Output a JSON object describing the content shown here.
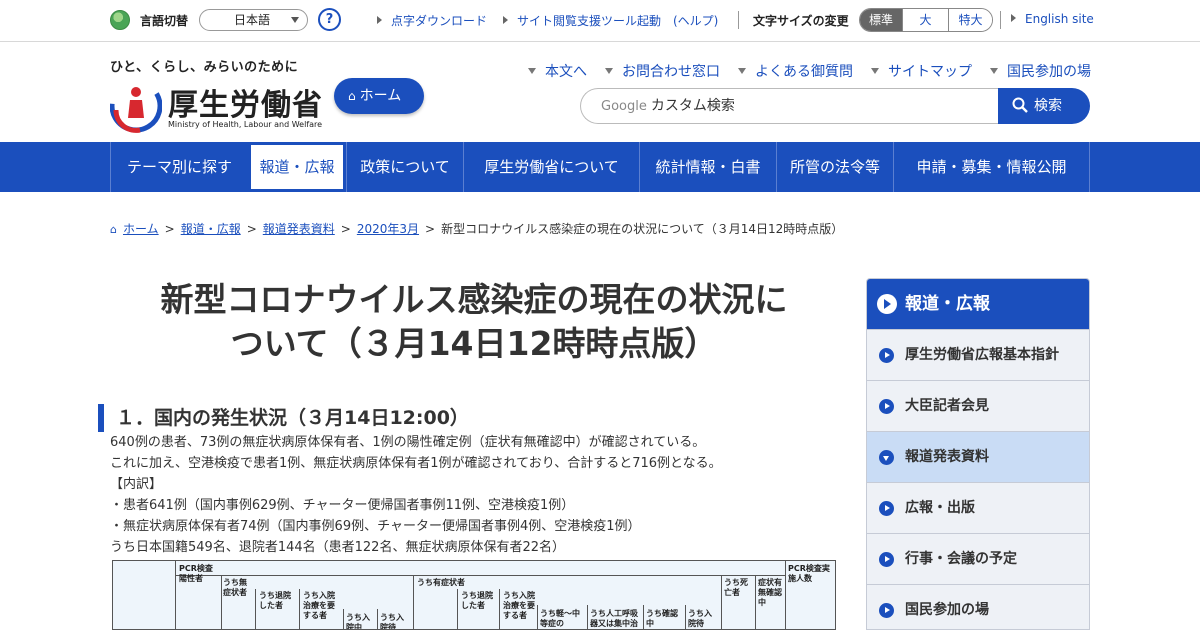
{
  "utility": {
    "lang_label": "言語切替",
    "lang_value": "日本語",
    "help": "?",
    "links": [
      {
        "label": "点字ダウンロード"
      },
      {
        "label": "サイト閲覧支援ツール起動　(ヘルプ)"
      },
      {
        "label": "English site"
      }
    ],
    "font_size_label": "文字サイズの変更",
    "font_sizes": [
      {
        "label": "標準",
        "active": true
      },
      {
        "label": "大",
        "active": false
      },
      {
        "label": "特大",
        "active": false
      }
    ]
  },
  "header": {
    "tagline": "ひと、くらし、みらいのために",
    "logo_text": "厚生労働省",
    "logo_en": "Ministry of Health, Labour and Welfare",
    "home_button": "ホーム",
    "links": [
      {
        "label": "本文へ"
      },
      {
        "label": "お問合わせ窓口"
      },
      {
        "label": "よくある御質問"
      },
      {
        "label": "サイトマップ"
      },
      {
        "label": "国民参加の場"
      }
    ],
    "search": {
      "google": "Google",
      "placeholder": "カスタム検索",
      "button": "検索"
    }
  },
  "gnav": [
    {
      "label": "テーマ別に探す"
    },
    {
      "label": "報道・広報",
      "active": true
    },
    {
      "label": "政策について"
    },
    {
      "label": "厚生労働省について"
    },
    {
      "label": "統計情報・白書"
    },
    {
      "label": "所管の法令等"
    },
    {
      "label": "申請・募集・情報公開"
    }
  ],
  "breadcrumb": {
    "links": [
      "ホーム",
      "報道・広報",
      "報道発表資料",
      "2020年3月"
    ],
    "current": "新型コロナウイルス感染症の現在の状況について（３月14日12時時点版）"
  },
  "main": {
    "title_line1": "新型コロナウイルス感染症の現在の状況に",
    "title_line2": "ついて（３月14日12時時点版）",
    "section_heading": "１．国内の発生状況（３月14日12:00）",
    "lines": [
      "640例の患者、73例の無症状病原体保有者、1例の陽性確定例（症状有無確認中）が確認されている。",
      "これに加え、空港検疫で患者1例、無症状病原体保有者1例が確認されており、合計すると716例となる。",
      "【内訳】",
      "・患者641例（国内事例629例、チャーター便帰国者事例11例、空港検疫1例）",
      "・無症状病原体保有者74例（国内事例69例、チャーター便帰国者事例4例、空港検疫1例）",
      "うち日本国籍549名、退院者144名（患者122名、無症状病原体保有者22名）"
    ],
    "table": {
      "h_pcr": "PCR検査陽性者",
      "h_patients": "うち無症状者",
      "h_discharged": "うち退院した者",
      "h_hosp": "うち入院治療を要する者",
      "h_hosp2": "うち入院中",
      "h_hosp3": "うち入院待",
      "h_symptom": "うち有症状者",
      "h_disc2": "うち退院した者",
      "h_hosp4": "うち入院治療を要する者",
      "h_mild": "うち軽～中等症の",
      "h_severe": "うち人工呼吸器又は集中治",
      "h_confirm": "うち確認中",
      "h_hosp5": "うち入院待",
      "h_death": "うち死亡者",
      "h_unknown": "症状有無確認中",
      "h_tested": "PCR検査実施人数"
    }
  },
  "sidenav": {
    "title": "報道・広報",
    "items": [
      {
        "label": "厚生労働省広報基本指針",
        "active": false
      },
      {
        "label": "大臣記者会見",
        "active": false
      },
      {
        "label": "報道発表資料",
        "active": true
      },
      {
        "label": "広報・出版",
        "active": false
      },
      {
        "label": "行事・会議の予定",
        "active": false
      },
      {
        "label": "国民参加の場",
        "active": false
      }
    ]
  },
  "colors": {
    "primary": "#1b4fbd",
    "side_bg": "#eef1f6",
    "side_active": "#c9dcf5"
  }
}
